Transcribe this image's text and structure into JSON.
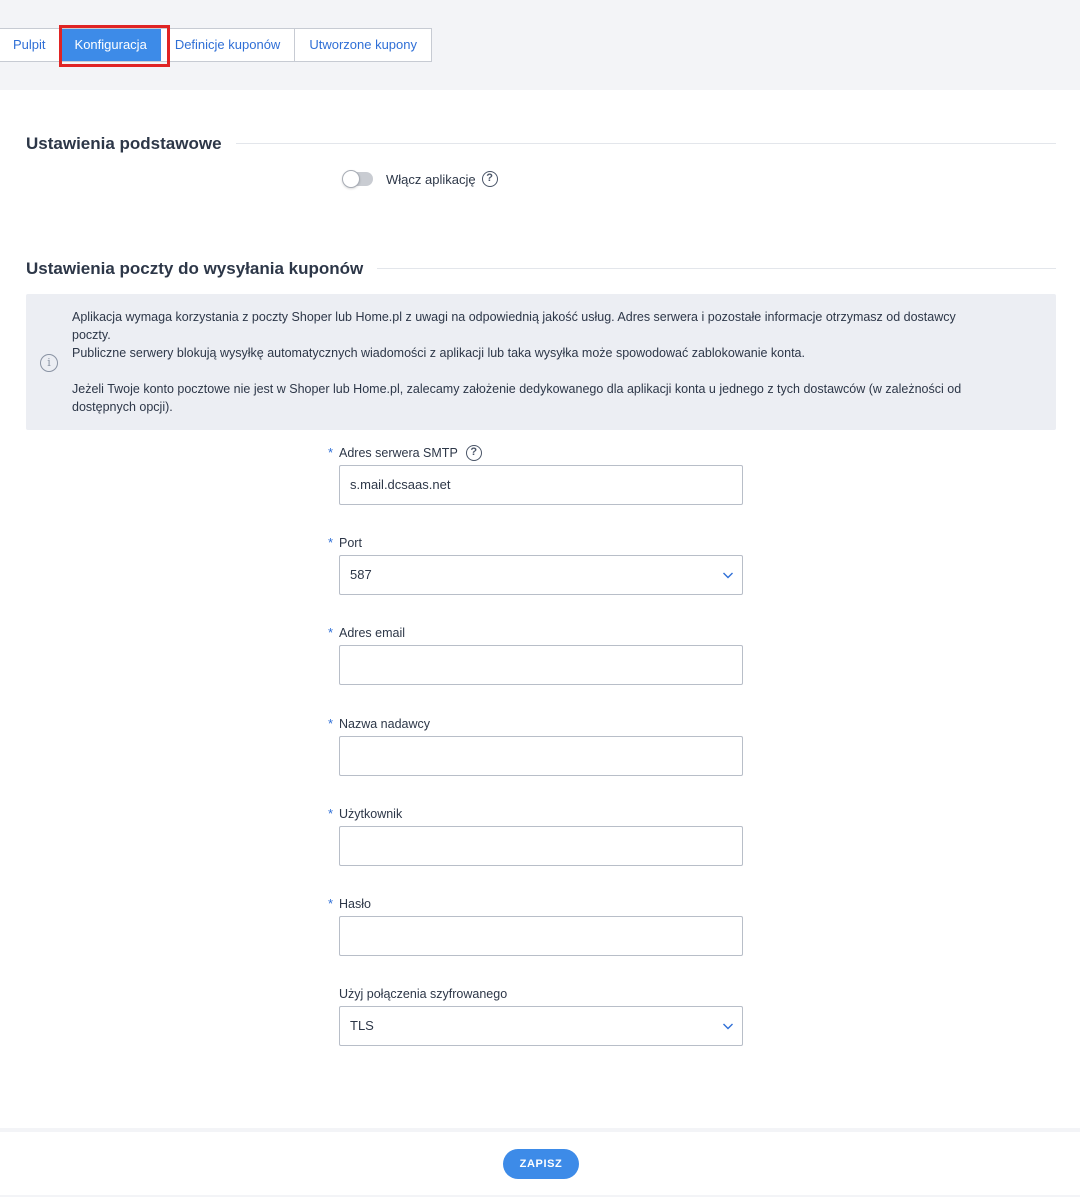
{
  "tabs": [
    {
      "label": "Pulpit",
      "active": false
    },
    {
      "label": "Konfiguracja",
      "active": true
    },
    {
      "label": "Definicje kuponów",
      "active": false
    },
    {
      "label": "Utworzone kupony",
      "active": false
    }
  ],
  "colors": {
    "accent": "#3d8be8",
    "highlight": "#e02424",
    "required": "#2f6fd6"
  },
  "basic": {
    "title": "Ustawienia podstawowe",
    "toggle_label": "Włącz aplikację",
    "toggle_on": false
  },
  "mail": {
    "title": "Ustawienia poczty do wysyłania kuponów",
    "info_line1": "Aplikacja wymaga korzystania z poczty Shoper lub Home.pl z uwagi na odpowiednią jakość usług. Adres serwera i pozostałe informacje otrzymasz od dostawcy poczty.",
    "info_line2": "Publiczne serwery blokują wysyłkę automatycznych wiadomości z aplikacji lub taka wysyłka może spowodować zablokowanie konta.",
    "info_line3": "Jeżeli Twoje konto pocztowe nie jest w Shoper lub Home.pl, zalecamy założenie dedykowanego dla aplikacji konta u jednego z tych dostawców (w zależności od dostępnych opcji)."
  },
  "fields": {
    "smtp": {
      "label": "Adres serwera SMTP",
      "value": "s.mail.dcsaas.net"
    },
    "port": {
      "label": "Port",
      "value": "587"
    },
    "email": {
      "label": "Adres email",
      "value": ""
    },
    "sender": {
      "label": "Nazwa nadawcy",
      "value": ""
    },
    "user": {
      "label": "Użytkownik",
      "value": ""
    },
    "password": {
      "label": "Hasło",
      "value": ""
    },
    "encryption": {
      "label": "Użyj połączenia szyfrowanego",
      "value": "TLS"
    }
  },
  "required_mark": "*",
  "help_glyph": "?",
  "info_glyph": "i",
  "save_label": "ZAPISZ"
}
